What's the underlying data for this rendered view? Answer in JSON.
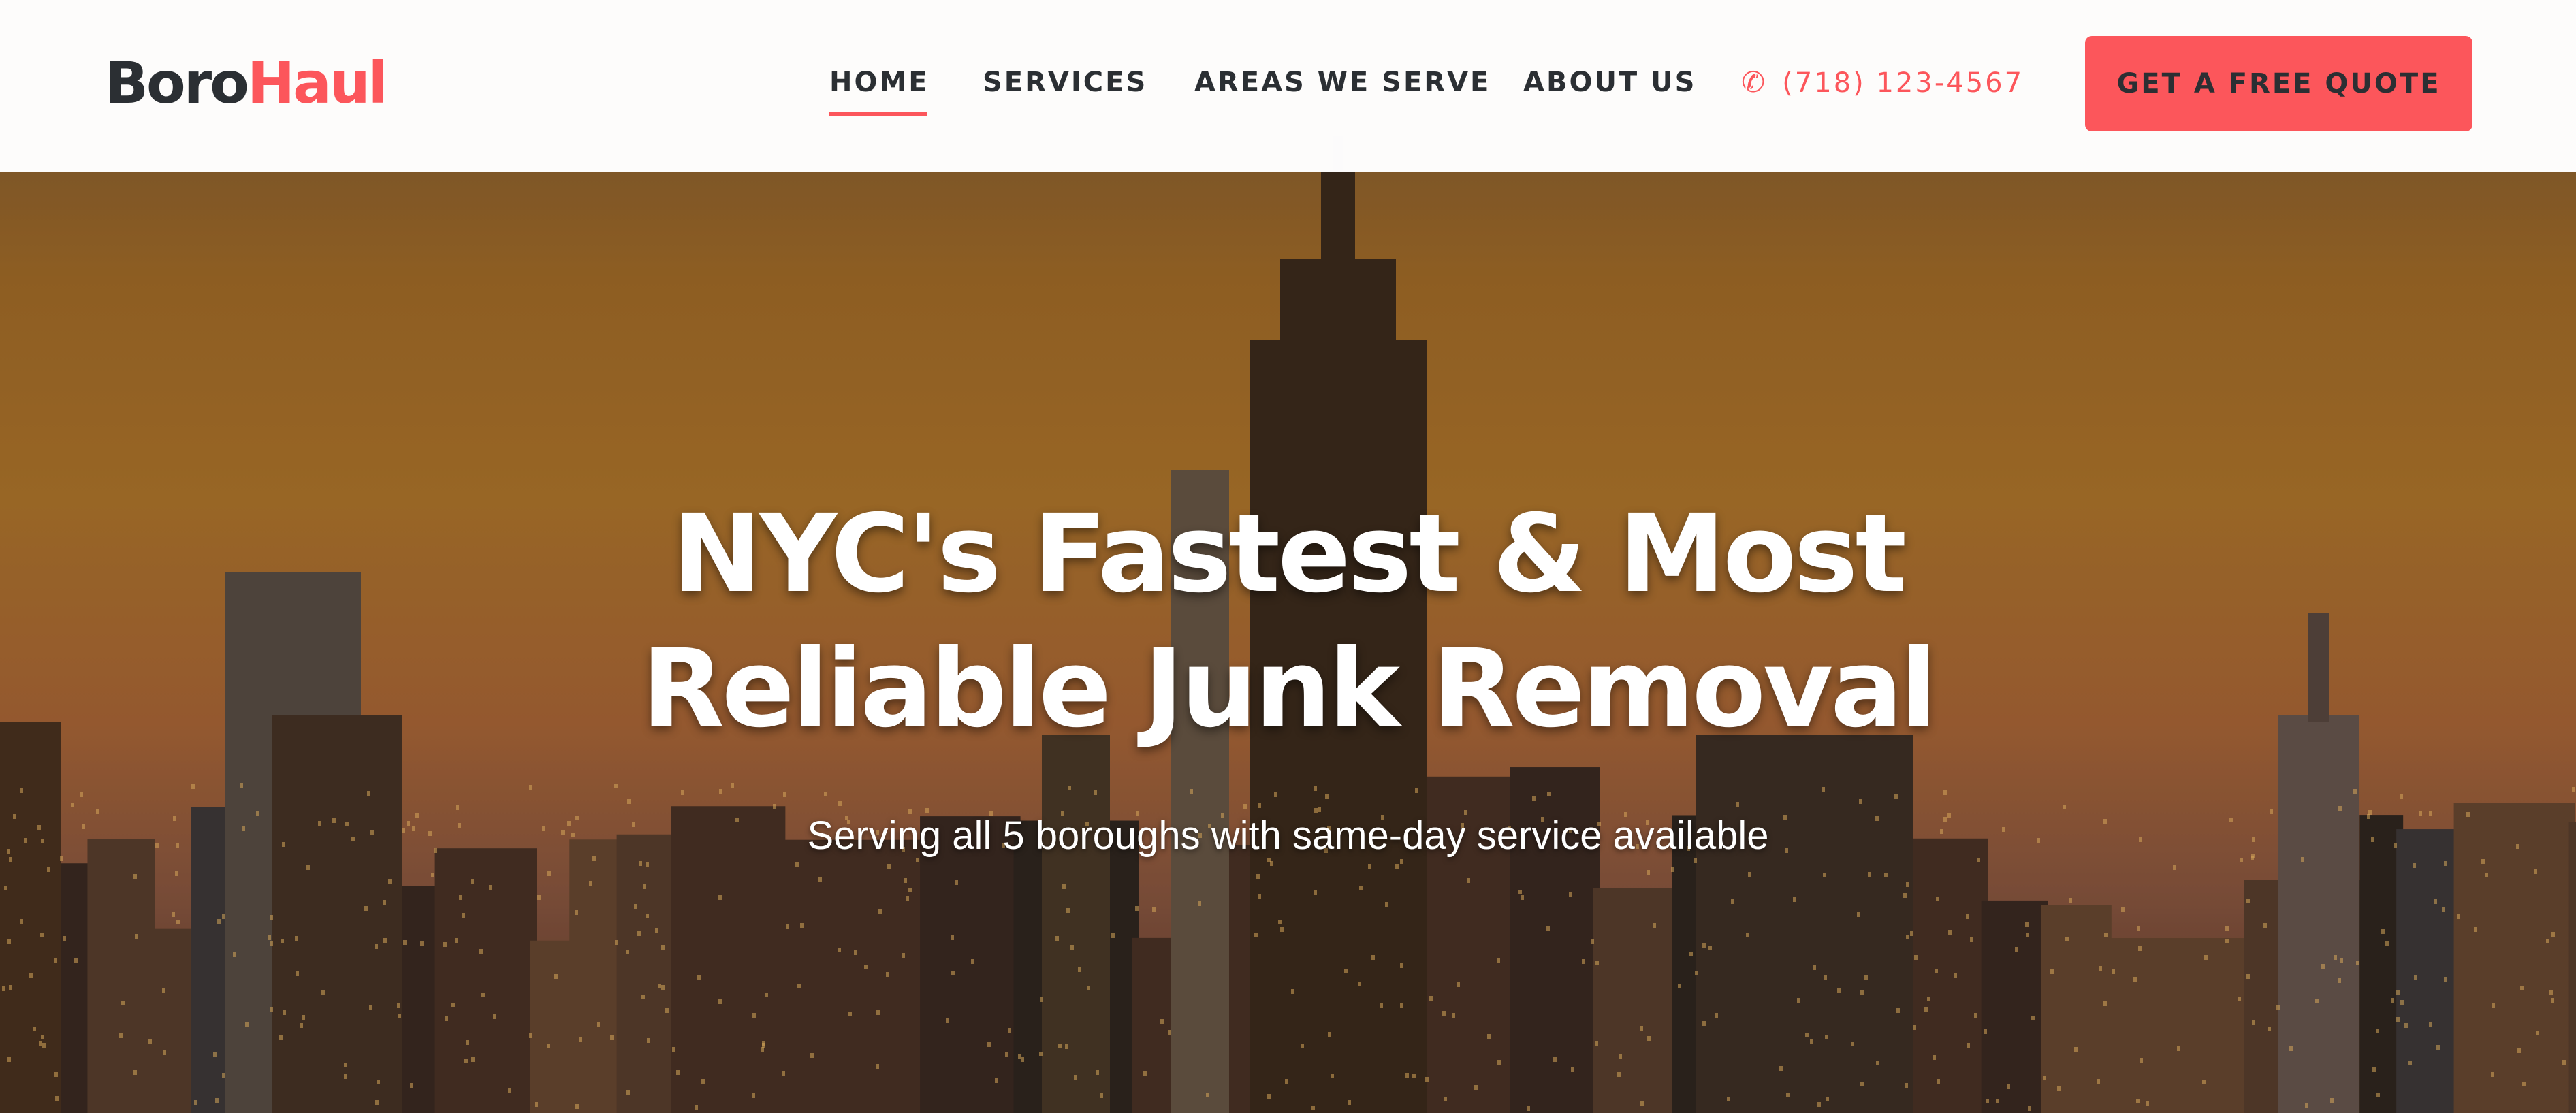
{
  "brand": {
    "part1": "Boro",
    "part2": "Haul"
  },
  "nav": {
    "items": [
      {
        "label": "HOME",
        "active": true
      },
      {
        "label": "SERVICES"
      },
      {
        "label": "AREAS WE SERVE"
      },
      {
        "label": "ABOUT US"
      }
    ],
    "phone": "(718) 123-4567",
    "phone_icon": "phone-icon",
    "cta": "GET A FREE QUOTE"
  },
  "hero": {
    "title_line1": "NYC's Fastest & Most",
    "title_line2": "Reliable Junk Removal",
    "subtitle": "Serving all 5 boroughs with same-day service available"
  },
  "colors": {
    "accent": "#fc565b",
    "text": "#2b2f33"
  }
}
